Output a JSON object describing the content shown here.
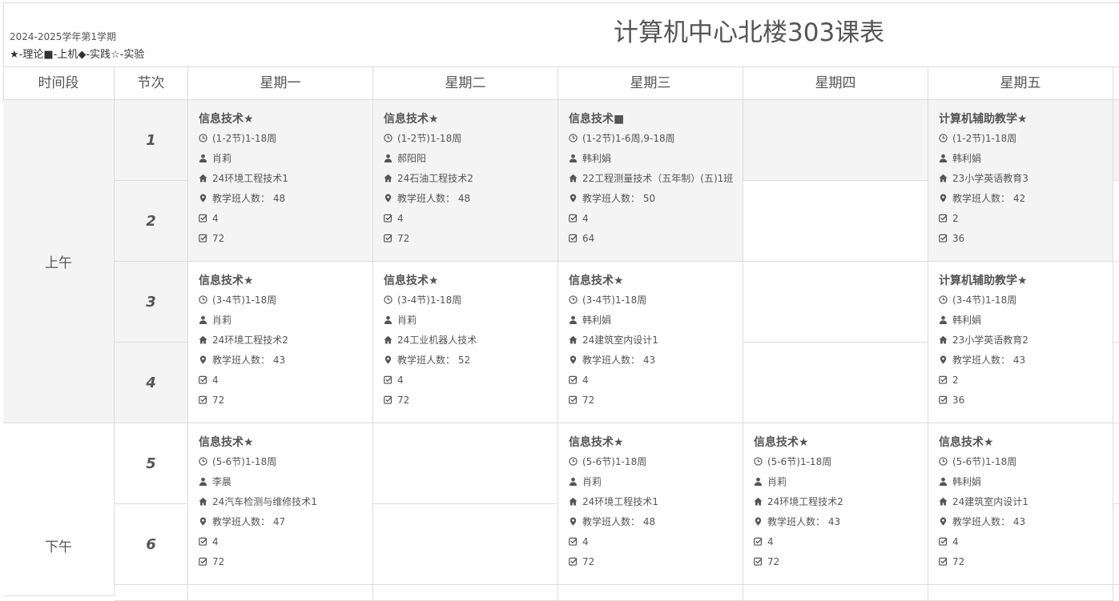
{
  "header": {
    "term": "2024-2025学年第1学期",
    "legend": "★-理论■-上机◆-实践☆-实验",
    "title": "计算机中心北楼303课表"
  },
  "columns": [
    "时间段",
    "节次",
    "星期一",
    "星期二",
    "星期三",
    "星期四",
    "星期五"
  ],
  "periods": [
    "上午",
    "下午"
  ],
  "sections": [
    "1",
    "2",
    "3",
    "4",
    "5",
    "6"
  ],
  "courses": [
    {
      "name": "信息技术★",
      "time": "(1-2节)1-18周",
      "teacher": "肖莉",
      "cls": "24环境工程技术1",
      "size": "教学班人数： 48",
      "credit": "4",
      "hours": "72"
    },
    {
      "name": "信息技术★",
      "time": "(1-2节)1-18周",
      "teacher": "郝阳阳",
      "cls": "24石油工程技术2",
      "size": "教学班人数： 48",
      "credit": "4",
      "hours": "72"
    },
    {
      "name": "信息技术■",
      "time": "(1-2节)1-6周,9-18周",
      "teacher": "韩利娟",
      "cls": "22工程测量技术（五年制）(五)1班",
      "size": "教学班人数： 50",
      "credit": "4",
      "hours": "64"
    },
    {
      "name": "计算机辅助教学★",
      "time": "(1-2节)1-18周",
      "teacher": "韩利娟",
      "cls": "23小学英语教育3",
      "size": "教学班人数： 42",
      "credit": "2",
      "hours": "36"
    },
    {
      "name": "信息技术★",
      "time": "(3-4节)1-18周",
      "teacher": "肖莉",
      "cls": "24环境工程技术2",
      "size": "教学班人数： 43",
      "credit": "4",
      "hours": "72"
    },
    {
      "name": "信息技术★",
      "time": "(3-4节)1-18周",
      "teacher": "肖莉",
      "cls": "24工业机器人技术",
      "size": "教学班人数： 52",
      "credit": "4",
      "hours": "72"
    },
    {
      "name": "信息技术★",
      "time": "(3-4节)1-18周",
      "teacher": "韩利娟",
      "cls": "24建筑室内设计1",
      "size": "教学班人数： 43",
      "credit": "4",
      "hours": "72"
    },
    {
      "name": "计算机辅助教学★",
      "time": "(3-4节)1-18周",
      "teacher": "韩利娟",
      "cls": "23小学英语教育2",
      "size": "教学班人数： 43",
      "credit": "2",
      "hours": "36"
    },
    {
      "name": "信息技术★",
      "time": "(5-6节)1-18周",
      "teacher": "李晨",
      "cls": "24汽车检测与维修技术1",
      "size": "教学班人数： 47",
      "credit": "4",
      "hours": "72"
    },
    {
      "name": "信息技术★",
      "time": "(5-6节)1-18周",
      "teacher": "肖莉",
      "cls": "24环境工程技术1",
      "size": "教学班人数： 48",
      "credit": "4",
      "hours": "72"
    },
    {
      "name": "信息技术★",
      "time": "(5-6节)1-18周",
      "teacher": "肖莉",
      "cls": "24环境工程技术2",
      "size": "教学班人数： 43",
      "credit": "4",
      "hours": "72"
    },
    {
      "name": "信息技术★",
      "time": "(5-6节)1-18周",
      "teacher": "韩利娟",
      "cls": "24建筑室内设计1",
      "size": "教学班人数： 43",
      "credit": "4",
      "hours": "72"
    }
  ]
}
